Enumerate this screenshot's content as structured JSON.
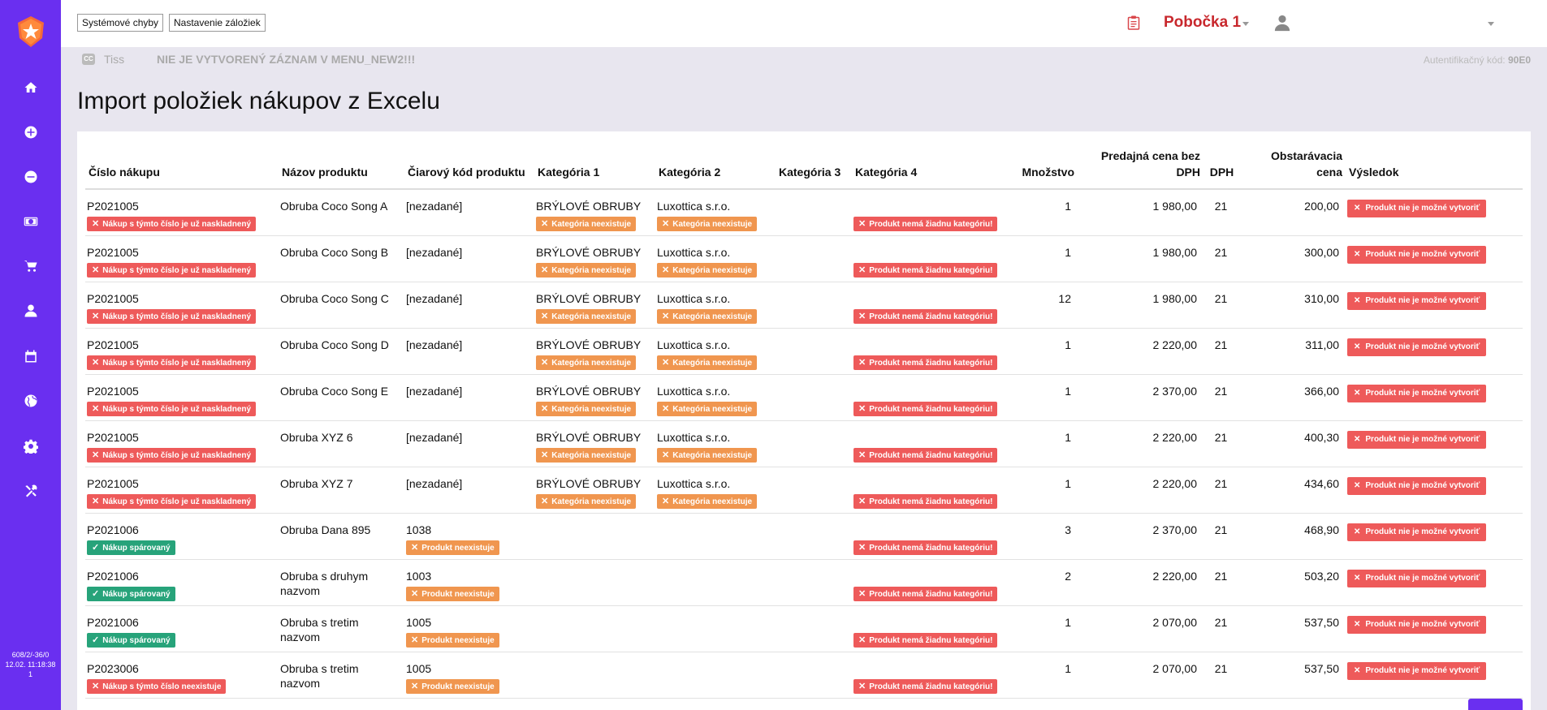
{
  "topbar": {
    "btn_errors": "Systémové chyby",
    "btn_bookmarks": "Nastavenie záložiek",
    "branch": "Pobočka 1"
  },
  "subbar": {
    "tiss": "Tiss",
    "message": "NIE JE VYTVORENÝ ZÁZNAM V MENU_NEW2!!!",
    "auth_label": "Autentifikačný kód:",
    "auth_code": "90E0"
  },
  "sidebar": {
    "icons": [
      "home-icon",
      "add-circle-icon",
      "remove-circle-icon",
      "money-icon",
      "cart-icon",
      "person-icon",
      "calendar-icon",
      "globe-icon",
      "gear-icon",
      "tools-icon"
    ],
    "footer_line1": "608/2/-36/0",
    "footer_line2": "12.02. 11:18:38",
    "footer_line3": "1"
  },
  "page": {
    "title": "Import položiek nákupov z Excelu"
  },
  "table": {
    "headers": [
      "Číslo nákupu",
      "Názov produktu",
      "Čiarový kód produktu",
      "Kategória 1",
      "Kategória 2",
      "Kategória 3",
      "Kategória 4",
      "Množstvo",
      "Predajná cena bez DPH",
      "DPH",
      "Obstarávacia cena",
      "Výsledok"
    ],
    "rows": [
      {
        "num": "P2021005",
        "num_badge": "Nákup s týmto číslo je už naskladnený",
        "num_badge_type": "red",
        "name": "Obruba Coco Song A",
        "code": "[nezadané]",
        "code_badge": "",
        "cat1": "BRÝLOVÉ OBRUBY",
        "cat1_badge": "Kategória neexistuje",
        "cat2": "Luxottica s.r.o.",
        "cat2_badge": "Kategória neexistuje",
        "cat4_badge": "Produkt nemá žiadnu kategóriu!",
        "qty": "1",
        "price": "1 980,00",
        "vat": "21",
        "cost": "200,00",
        "result": "Produkt nie je možné vytvoriť"
      },
      {
        "num": "P2021005",
        "num_badge": "Nákup s týmto číslo je už naskladnený",
        "num_badge_type": "red",
        "name": "Obruba Coco Song B",
        "code": "[nezadané]",
        "code_badge": "",
        "cat1": "BRÝLOVÉ OBRUBY",
        "cat1_badge": "Kategória neexistuje",
        "cat2": "Luxottica s.r.o.",
        "cat2_badge": "Kategória neexistuje",
        "cat4_badge": "Produkt nemá žiadnu kategóriu!",
        "qty": "1",
        "price": "1 980,00",
        "vat": "21",
        "cost": "300,00",
        "result": "Produkt nie je možné vytvoriť"
      },
      {
        "num": "P2021005",
        "num_badge": "Nákup s týmto číslo je už naskladnený",
        "num_badge_type": "red",
        "name": "Obruba Coco Song C",
        "code": "[nezadané]",
        "code_badge": "",
        "cat1": "BRÝLOVÉ OBRUBY",
        "cat1_badge": "Kategória neexistuje",
        "cat2": "Luxottica s.r.o.",
        "cat2_badge": "Kategória neexistuje",
        "cat4_badge": "Produkt nemá žiadnu kategóriu!",
        "qty": "12",
        "price": "1 980,00",
        "vat": "21",
        "cost": "310,00",
        "result": "Produkt nie je možné vytvoriť"
      },
      {
        "num": "P2021005",
        "num_badge": "Nákup s týmto číslo je už naskladnený",
        "num_badge_type": "red",
        "name": "Obruba Coco Song D",
        "code": "[nezadané]",
        "code_badge": "",
        "cat1": "BRÝLOVÉ OBRUBY",
        "cat1_badge": "Kategória neexistuje",
        "cat2": "Luxottica s.r.o.",
        "cat2_badge": "Kategória neexistuje",
        "cat4_badge": "Produkt nemá žiadnu kategóriu!",
        "qty": "1",
        "price": "2 220,00",
        "vat": "21",
        "cost": "311,00",
        "result": "Produkt nie je možné vytvoriť"
      },
      {
        "num": "P2021005",
        "num_badge": "Nákup s týmto číslo je už naskladnený",
        "num_badge_type": "red",
        "name": "Obruba Coco Song E",
        "code": "[nezadané]",
        "code_badge": "",
        "cat1": "BRÝLOVÉ OBRUBY",
        "cat1_badge": "Kategória neexistuje",
        "cat2": "Luxottica s.r.o.",
        "cat2_badge": "Kategória neexistuje",
        "cat4_badge": "Produkt nemá žiadnu kategóriu!",
        "qty": "1",
        "price": "2 370,00",
        "vat": "21",
        "cost": "366,00",
        "result": "Produkt nie je možné vytvoriť"
      },
      {
        "num": "P2021005",
        "num_badge": "Nákup s týmto číslo je už naskladnený",
        "num_badge_type": "red",
        "name": "Obruba XYZ 6",
        "code": "[nezadané]",
        "code_badge": "",
        "cat1": "BRÝLOVÉ OBRUBY",
        "cat1_badge": "Kategória neexistuje",
        "cat2": "Luxottica s.r.o.",
        "cat2_badge": "Kategória neexistuje",
        "cat4_badge": "Produkt nemá žiadnu kategóriu!",
        "qty": "1",
        "price": "2 220,00",
        "vat": "21",
        "cost": "400,30",
        "result": "Produkt nie je možné vytvoriť"
      },
      {
        "num": "P2021005",
        "num_badge": "Nákup s týmto číslo je už naskladnený",
        "num_badge_type": "red",
        "name": "Obruba XYZ 7",
        "code": "[nezadané]",
        "code_badge": "",
        "cat1": "BRÝLOVÉ OBRUBY",
        "cat1_badge": "Kategória neexistuje",
        "cat2": "Luxottica s.r.o.",
        "cat2_badge": "Kategória neexistuje",
        "cat4_badge": "Produkt nemá žiadnu kategóriu!",
        "qty": "1",
        "price": "2 220,00",
        "vat": "21",
        "cost": "434,60",
        "result": "Produkt nie je možné vytvoriť"
      },
      {
        "num": "P2021006",
        "num_badge": "Nákup spárovaný",
        "num_badge_type": "green",
        "name": "Obruba Dana 895",
        "code": "1038",
        "code_badge": "Produkt neexistuje",
        "cat1": "",
        "cat1_badge": "",
        "cat2": "",
        "cat2_badge": "",
        "cat4_badge": "Produkt nemá žiadnu kategóriu!",
        "qty": "3",
        "price": "2 370,00",
        "vat": "21",
        "cost": "468,90",
        "result": "Produkt nie je možné vytvoriť"
      },
      {
        "num": "P2021006",
        "num_badge": "Nákup spárovaný",
        "num_badge_type": "green",
        "name": "Obruba s druhym nazvom",
        "code": "1003",
        "code_badge": "Produkt neexistuje",
        "cat1": "",
        "cat1_badge": "",
        "cat2": "",
        "cat2_badge": "",
        "cat4_badge": "Produkt nemá žiadnu kategóriu!",
        "qty": "2",
        "price": "2 220,00",
        "vat": "21",
        "cost": "503,20",
        "result": "Produkt nie je možné vytvoriť"
      },
      {
        "num": "P2021006",
        "num_badge": "Nákup spárovaný",
        "num_badge_type": "green",
        "name": "Obruba s tretim nazvom",
        "code": "1005",
        "code_badge": "Produkt neexistuje",
        "cat1": "",
        "cat1_badge": "",
        "cat2": "",
        "cat2_badge": "",
        "cat4_badge": "Produkt nemá žiadnu kategóriu!",
        "qty": "1",
        "price": "2 070,00",
        "vat": "21",
        "cost": "537,50",
        "result": "Produkt nie je možné vytvoriť"
      },
      {
        "num": "P2023006",
        "num_badge": "Nákup s týmto číslo neexistuje",
        "num_badge_type": "red",
        "name": "Obruba s tretim nazvom",
        "code": "1005",
        "code_badge": "Produkt neexistuje",
        "cat1": "",
        "cat1_badge": "",
        "cat2": "",
        "cat2_badge": "",
        "cat4_badge": "Produkt nemá žiadnu kategóriu!",
        "qty": "1",
        "price": "2 070,00",
        "vat": "21",
        "cost": "537,50",
        "result": "Produkt nie je možné vytvoriť"
      }
    ]
  }
}
